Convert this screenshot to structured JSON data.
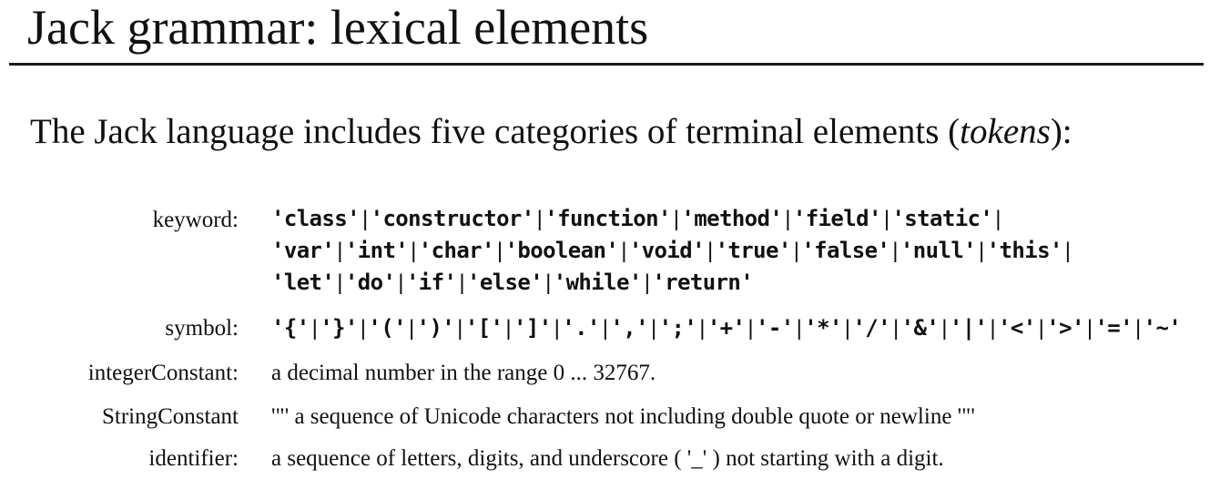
{
  "title": "Jack grammar: lexical elements",
  "intro": {
    "before": "The Jack language includes five categories of terminal elements (",
    "emphasis": "tokens",
    "after": "):"
  },
  "rows": {
    "keyword": {
      "label": "keyword:",
      "lines": [
        [
          "'class'",
          "'constructor'",
          "'function'",
          "'method'",
          "'field'",
          "'static'"
        ],
        [
          "'var'",
          "'int'",
          "'char'",
          "'boolean'",
          "'void'",
          "'true'",
          "'false'",
          "'null'",
          "'this'"
        ],
        [
          "'let'",
          "'do'",
          "'if'",
          "'else'",
          "'while'",
          "'return'"
        ]
      ],
      "line_trailing_sep": [
        true,
        true,
        false
      ]
    },
    "symbol": {
      "label": "symbol:",
      "tokens": [
        "'{'",
        "'}'",
        "'('",
        "')'",
        "'['",
        "']'",
        "'.'",
        "','",
        "';'",
        "'+'",
        "'-'",
        "'*'",
        "'/'",
        "'&'",
        "'|'",
        "'<'",
        "'>'",
        "'='",
        "'~'"
      ]
    },
    "integer": {
      "label": "integerConstant:",
      "text": "a decimal number in the range 0 ... 32767."
    },
    "string": {
      "label": "StringConstant",
      "text": "'\"' a sequence of Unicode characters not including double quote or newline '\"'"
    },
    "identifier": {
      "label": "identifier:",
      "text": "a sequence of letters, digits, and underscore ( '_' ) not starting with a digit."
    }
  },
  "separator": "|"
}
